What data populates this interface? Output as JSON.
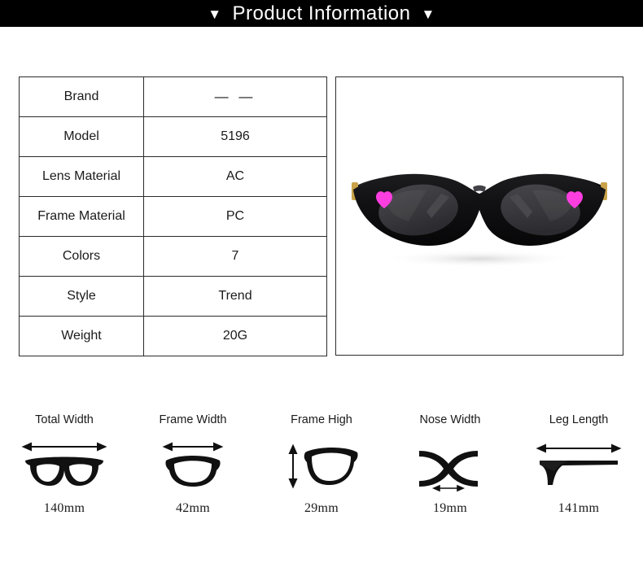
{
  "header": {
    "title": "Product Information",
    "left_caret": "▼",
    "right_caret": "▼",
    "background_color": "#000000",
    "text_color": "#ffffff"
  },
  "spec_table": {
    "rows": [
      {
        "key": "Brand",
        "value": "— —"
      },
      {
        "key": "Model",
        "value": "5196"
      },
      {
        "key": "Lens Material",
        "value": "AC"
      },
      {
        "key": "Frame Material",
        "value": "PC"
      },
      {
        "key": "Colors",
        "value": "7"
      },
      {
        "key": "Style",
        "value": "Trend"
      },
      {
        "key": "Weight",
        "value": "20G"
      }
    ]
  },
  "product_image": {
    "alt": "black cat-eye sunglasses with pink heart accents",
    "frame_color": "#101012",
    "lens_color": "#3a3a3e",
    "heart_color": "#ff3ee0",
    "background_color": "#ffffff"
  },
  "measurements": [
    {
      "label": "Total Width",
      "value": "140mm",
      "icon": "full-glasses-icon",
      "arrow": "horizontal-double-arrow"
    },
    {
      "label": "Frame Width",
      "value": "42mm",
      "icon": "single-lens-icon",
      "arrow": "horizontal-double-arrow"
    },
    {
      "label": "Frame High",
      "value": "29mm",
      "icon": "single-lens-icon",
      "arrow": "vertical-double-arrow"
    },
    {
      "label": "Nose Width",
      "value": "19mm",
      "icon": "nose-bridge-icon",
      "arrow": "horizontal-double-arrow"
    },
    {
      "label": "Leg Length",
      "value": "141mm",
      "icon": "temple-arm-icon",
      "arrow": "horizontal-double-arrow"
    }
  ]
}
